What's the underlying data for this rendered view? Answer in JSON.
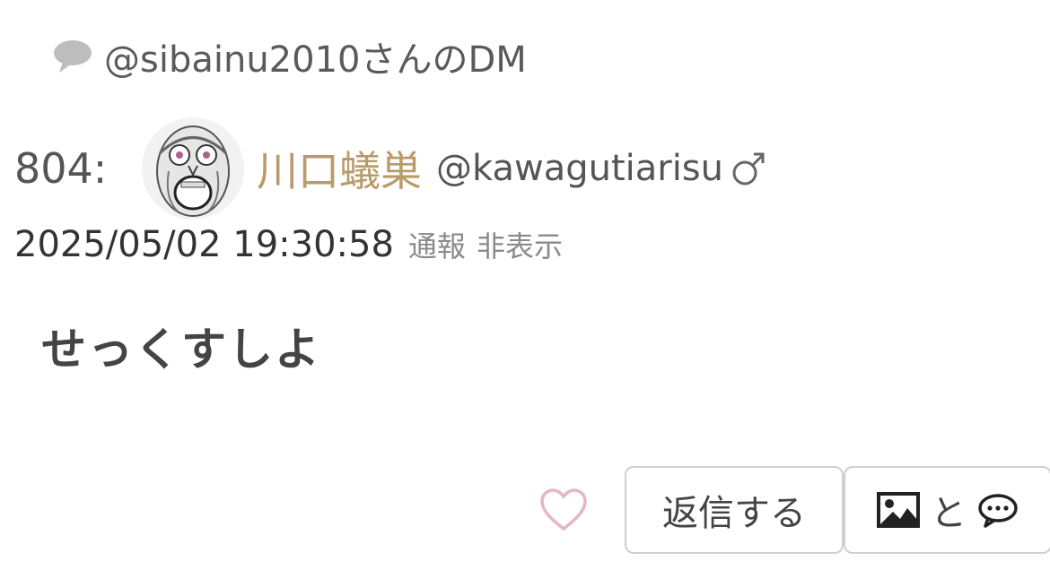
{
  "thread": {
    "dm_label": "@sibainu2010さんのDM"
  },
  "post": {
    "number": "804:",
    "author_name": "川口蟻巣",
    "author_handle": "@kawagutiarisu",
    "gender_icon": "male-symbol-icon",
    "timestamp": "2025/05/02 19:30:58",
    "report_label": "通報",
    "hide_label": "非表示",
    "message": "せっくすしよ"
  },
  "actions": {
    "like_icon": "heart-outline-icon",
    "reply_label": "返信する",
    "media_reply_label": "と"
  },
  "colors": {
    "author_name": "#b99a6a",
    "like_heart": "#e8b4c8",
    "button_border": "#cfcfcf",
    "meta_link": "#8a8a8a"
  }
}
